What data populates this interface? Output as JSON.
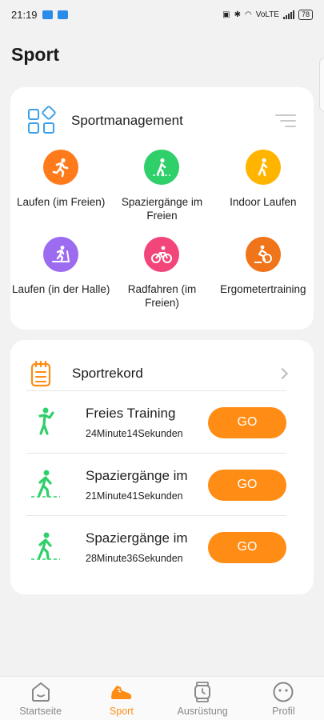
{
  "status_bar": {
    "time": "21:19",
    "network": "VoLTE",
    "battery": "78"
  },
  "page": {
    "title": "Sport"
  },
  "management": {
    "title": "Sportmanagement",
    "items": [
      {
        "label": "Laufen (im Freien)",
        "color": "#ff7a1a",
        "icon": "run-icon"
      },
      {
        "label": "Spaziergänge im Freien",
        "color": "#2fcf6a",
        "icon": "walk-icon"
      },
      {
        "label": "Indoor Laufen",
        "color": "#ffb400",
        "icon": "walk-indoor-icon"
      },
      {
        "label": "Laufen (in der Halle)",
        "color": "#9c6bf0",
        "icon": "treadmill-icon"
      },
      {
        "label": "Radfahren (im Freien)",
        "color": "#f2467a",
        "icon": "bike-icon"
      },
      {
        "label": "Ergometertraining",
        "color": "#f0741a",
        "icon": "ergometer-icon"
      }
    ]
  },
  "records": {
    "title": "Sportrekord",
    "items": [
      {
        "title": "Freies Training",
        "duration": "24Minute14Sekunden",
        "button": "GO"
      },
      {
        "title": "Spaziergänge im",
        "duration": "21Minute41Sekunden",
        "button": "GO"
      },
      {
        "title": "Spaziergänge im",
        "duration": "28Minute36Sekunden",
        "button": "GO"
      }
    ]
  },
  "tabbar": {
    "tabs": [
      {
        "label": "Startseite",
        "icon": "home-icon"
      },
      {
        "label": "Sport",
        "icon": "shoe-icon",
        "active": true
      },
      {
        "label": "Ausrüstung",
        "icon": "watch-icon"
      },
      {
        "label": "Profil",
        "icon": "face-icon"
      }
    ]
  },
  "colors": {
    "accent": "#ff8c14",
    "walk_green": "#2fcf6a",
    "mgmt_icon": "#3aa0e8"
  }
}
